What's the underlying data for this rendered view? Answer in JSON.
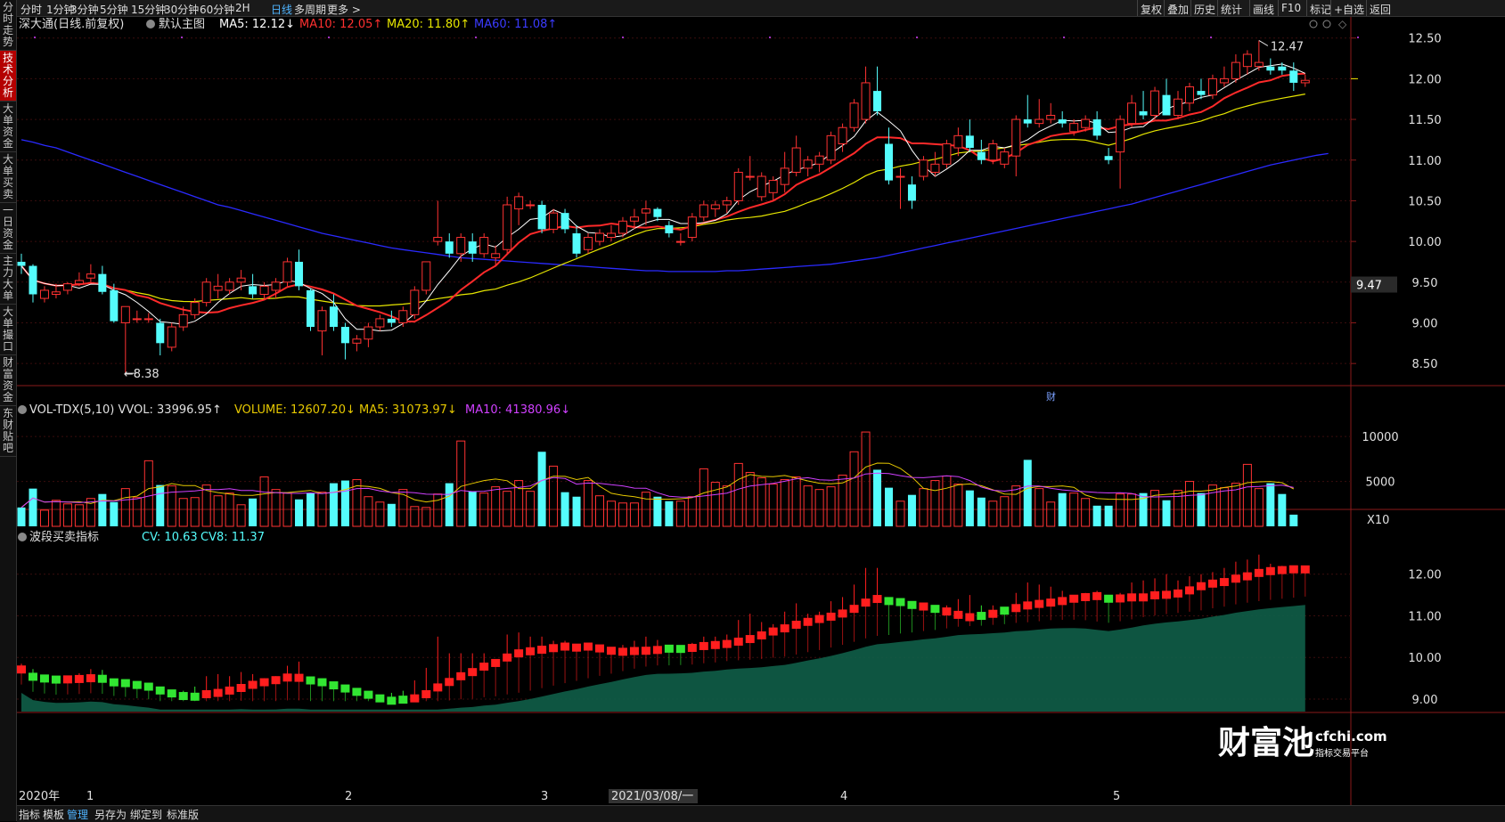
{
  "sidebar": [
    "分时走势",
    "技术分析",
    "大单资金",
    "大单买卖",
    "一日资金",
    "主力大单",
    "大单撮口",
    "财富资金",
    "东财贴吧"
  ],
  "sidebar_active": 1,
  "periods": [
    "分时",
    "1分钟",
    "3分钟",
    "5分钟",
    "15分钟",
    "30分钟",
    "60分钟",
    "2H",
    "日线",
    "多周期",
    "更多 >"
  ],
  "period_active": 8,
  "tools": [
    "复权",
    "叠加",
    "历史",
    "统计",
    "画线",
    "F10",
    "标记",
    "+自选",
    "返回"
  ],
  "main": {
    "title": "深大通(日线.前复权)",
    "template": "默认主图",
    "ma5": "MA5: 12.12↓",
    "ma10": "MA10: 12.05↑",
    "ma20": "MA20: 11.80↑",
    "ma60": "MA60: 11.08↑",
    "high_label": "12.47",
    "low_label": "8.38",
    "current_price": "9.47",
    "marker": "财",
    "yticks": [
      "12.50",
      "12.00",
      "11.50",
      "11.00",
      "10.50",
      "10.00",
      "9.50",
      "9.00",
      "8.50"
    ]
  },
  "volume": {
    "title": "VOL-TDX(5,10) VVOL: 33996.95↑",
    "volume": "VOLUME: 12607.20↓",
    "ma5": "MA5: 31073.97↓",
    "ma10": "MA10: 41380.96↓",
    "yticks": [
      "10000",
      "5000"
    ],
    "unit": "X10"
  },
  "indicator": {
    "title": "波段买卖指标",
    "cv": "CV: 10.63",
    "cv8": "CV8: 11.37",
    "yticks": [
      "12.00",
      "11.00",
      "10.00",
      "9.00"
    ]
  },
  "xaxis": {
    "labels": [
      "2020年",
      "1",
      "2",
      "3",
      "4",
      "5"
    ],
    "cursor": "2021/03/08/一"
  },
  "bottom_tabs": [
    "指标",
    "模板",
    "管理",
    "另存为",
    "绑定到",
    "标准版"
  ],
  "bottom_active": 2,
  "watermark": {
    "brand": "财富池",
    "site": "cfchi.com",
    "slogan": "指标交易平台"
  },
  "colors": {
    "up": "#ff3232",
    "down": "#54fcfc",
    "ma5": "#ffffff",
    "ma10": "#ff2a2a",
    "ma20": "#e6e600",
    "ma60": "#2a2aff",
    "ma_vol10": "#d040ff",
    "cloud": "#0f5e48"
  },
  "chart_data": {
    "type": "candlestick",
    "price_range": [
      8.25,
      12.65
    ],
    "candles": [
      [
        9.75,
        9.85,
        9.6,
        9.7
      ],
      [
        9.7,
        9.72,
        9.25,
        9.35
      ],
      [
        9.3,
        9.45,
        9.25,
        9.4
      ],
      [
        9.35,
        9.48,
        9.3,
        9.38
      ],
      [
        9.4,
        9.5,
        9.35,
        9.48
      ],
      [
        9.48,
        9.62,
        9.45,
        9.52
      ],
      [
        9.55,
        9.72,
        9.5,
        9.6
      ],
      [
        9.6,
        9.7,
        9.35,
        9.38
      ],
      [
        9.4,
        9.48,
        9.0,
        9.02
      ],
      [
        9.0,
        9.2,
        8.38,
        9.2
      ],
      [
        9.05,
        9.15,
        9.0,
        9.05
      ],
      [
        9.05,
        9.12,
        9.0,
        9.05
      ],
      [
        9.0,
        9.05,
        8.6,
        8.75
      ],
      [
        8.7,
        9.0,
        8.65,
        8.95
      ],
      [
        8.95,
        9.2,
        8.9,
        9.1
      ],
      [
        9.1,
        9.3,
        9.05,
        9.25
      ],
      [
        9.25,
        9.55,
        9.2,
        9.5
      ],
      [
        9.4,
        9.6,
        9.3,
        9.45
      ],
      [
        9.4,
        9.55,
        9.35,
        9.5
      ],
      [
        9.5,
        9.65,
        9.4,
        9.55
      ],
      [
        9.45,
        9.6,
        9.3,
        9.35
      ],
      [
        9.35,
        9.5,
        9.3,
        9.45
      ],
      [
        9.4,
        9.55,
        9.3,
        9.5
      ],
      [
        9.5,
        9.8,
        9.45,
        9.75
      ],
      [
        9.75,
        9.9,
        9.4,
        9.45
      ],
      [
        9.4,
        9.42,
        8.9,
        8.95
      ],
      [
        8.9,
        9.2,
        8.6,
        9.15
      ],
      [
        9.2,
        9.35,
        8.9,
        8.95
      ],
      [
        8.95,
        9.0,
        8.55,
        8.75
      ],
      [
        8.75,
        8.85,
        8.65,
        8.8
      ],
      [
        8.8,
        9.0,
        8.7,
        8.95
      ],
      [
        8.95,
        9.1,
        8.9,
        9.05
      ],
      [
        9.05,
        9.15,
        8.95,
        9.0
      ],
      [
        9.0,
        9.2,
        8.95,
        9.15
      ],
      [
        9.1,
        9.45,
        9.05,
        9.4
      ],
      [
        9.4,
        9.75,
        9.35,
        9.75
      ],
      [
        10.0,
        10.5,
        9.95,
        10.05
      ],
      [
        10.0,
        10.1,
        9.8,
        9.85
      ],
      [
        9.85,
        10.1,
        9.75,
        10.05
      ],
      [
        10.0,
        10.1,
        9.75,
        9.85
      ],
      [
        9.85,
        10.1,
        9.8,
        10.05
      ],
      [
        9.8,
        9.95,
        9.7,
        9.85
      ],
      [
        9.9,
        10.55,
        9.85,
        10.45
      ],
      [
        10.4,
        10.6,
        10.2,
        10.55
      ],
      [
        10.45,
        10.5,
        10.4,
        10.45
      ],
      [
        10.45,
        10.5,
        10.1,
        10.15
      ],
      [
        10.15,
        10.4,
        10.1,
        10.35
      ],
      [
        10.35,
        10.4,
        10.1,
        10.15
      ],
      [
        10.1,
        10.2,
        9.8,
        9.85
      ],
      [
        9.9,
        10.1,
        9.85,
        10.05
      ],
      [
        10.0,
        10.15,
        9.95,
        10.1
      ],
      [
        10.05,
        10.2,
        10.0,
        10.1
      ],
      [
        10.1,
        10.3,
        10.05,
        10.25
      ],
      [
        10.25,
        10.4,
        10.15,
        10.3
      ],
      [
        10.35,
        10.5,
        10.2,
        10.4
      ],
      [
        10.4,
        10.42,
        10.25,
        10.3
      ],
      [
        10.2,
        10.25,
        10.05,
        10.1
      ],
      [
        10.0,
        10.1,
        9.95,
        10.0
      ],
      [
        10.05,
        10.35,
        10.0,
        10.3
      ],
      [
        10.3,
        10.5,
        10.25,
        10.45
      ],
      [
        10.4,
        10.5,
        10.3,
        10.45
      ],
      [
        10.45,
        10.55,
        10.35,
        10.5
      ],
      [
        10.5,
        10.9,
        10.45,
        10.85
      ],
      [
        10.8,
        11.05,
        10.75,
        10.8
      ],
      [
        10.55,
        10.85,
        10.5,
        10.8
      ],
      [
        10.6,
        10.8,
        10.5,
        10.75
      ],
      [
        10.7,
        11.1,
        10.6,
        10.9
      ],
      [
        10.85,
        11.3,
        10.8,
        11.15
      ],
      [
        10.9,
        11.05,
        10.8,
        11.0
      ],
      [
        10.95,
        11.1,
        10.85,
        11.05
      ],
      [
        11.0,
        11.35,
        10.95,
        11.3
      ],
      [
        11.2,
        11.45,
        11.1,
        11.4
      ],
      [
        11.4,
        11.75,
        11.35,
        11.7
      ],
      [
        11.5,
        12.15,
        11.45,
        11.95
      ],
      [
        11.85,
        12.15,
        11.55,
        11.6
      ],
      [
        11.2,
        11.4,
        10.7,
        10.75
      ],
      [
        10.8,
        10.9,
        10.4,
        10.8
      ],
      [
        10.7,
        10.8,
        10.4,
        10.5
      ],
      [
        10.8,
        11.05,
        10.75,
        11.0
      ],
      [
        10.85,
        11.1,
        10.8,
        10.95
      ],
      [
        10.95,
        11.25,
        10.9,
        11.2
      ],
      [
        11.15,
        11.4,
        11.05,
        11.3
      ],
      [
        11.3,
        11.5,
        11.1,
        11.15
      ],
      [
        11.1,
        11.25,
        10.95,
        11.0
      ],
      [
        11.0,
        11.25,
        10.95,
        11.2
      ],
      [
        10.95,
        11.15,
        10.9,
        11.1
      ],
      [
        11.05,
        11.55,
        10.8,
        11.5
      ],
      [
        11.5,
        11.8,
        11.4,
        11.45
      ],
      [
        11.45,
        11.75,
        11.4,
        11.5
      ],
      [
        11.5,
        11.7,
        11.45,
        11.55
      ],
      [
        11.5,
        11.6,
        11.4,
        11.45
      ],
      [
        11.35,
        11.5,
        11.3,
        11.45
      ],
      [
        11.4,
        11.55,
        11.35,
        11.5
      ],
      [
        11.5,
        11.6,
        11.25,
        11.3
      ],
      [
        11.05,
        11.15,
        10.95,
        11.0
      ],
      [
        11.1,
        11.55,
        10.65,
        11.5
      ],
      [
        11.45,
        11.8,
        11.4,
        11.7
      ],
      [
        11.6,
        11.85,
        11.5,
        11.55
      ],
      [
        11.55,
        11.9,
        11.5,
        11.85
      ],
      [
        11.8,
        12.0,
        11.6,
        11.55
      ],
      [
        11.55,
        11.85,
        11.5,
        11.75
      ],
      [
        11.7,
        11.95,
        11.6,
        11.9
      ],
      [
        11.85,
        12.0,
        11.75,
        11.8
      ],
      [
        11.8,
        12.05,
        11.75,
        12.0
      ],
      [
        11.95,
        12.15,
        11.9,
        12.0
      ],
      [
        12.0,
        12.3,
        11.95,
        12.2
      ],
      [
        12.15,
        12.35,
        12.05,
        12.3
      ],
      [
        12.15,
        12.47,
        12.1,
        12.2
      ],
      [
        12.15,
        12.25,
        12.05,
        12.1
      ],
      [
        12.15,
        12.2,
        12.05,
        12.1
      ],
      [
        12.1,
        12.2,
        11.85,
        11.95
      ],
      [
        11.95,
        12.05,
        11.9,
        11.98
      ]
    ],
    "ma60": [
      11.25,
      11.22,
      11.18,
      11.15,
      11.1,
      11.05,
      11.0,
      10.95,
      10.9,
      10.85,
      10.8,
      10.75,
      10.7,
      10.65,
      10.6,
      10.55,
      10.5,
      10.45,
      10.42,
      10.38,
      10.34,
      10.3,
      10.26,
      10.22,
      10.18,
      10.14,
      10.1,
      10.07,
      10.04,
      10.01,
      9.98,
      9.95,
      9.92,
      9.9,
      9.88,
      9.86,
      9.84,
      9.82,
      9.8,
      9.79,
      9.78,
      9.77,
      9.76,
      9.75,
      9.74,
      9.73,
      9.72,
      9.71,
      9.7,
      9.69,
      9.68,
      9.67,
      9.66,
      9.65,
      9.64,
      9.64,
      9.63,
      9.63,
      9.63,
      9.63,
      9.63,
      9.64,
      9.64,
      9.65,
      9.66,
      9.67,
      9.68,
      9.69,
      9.7,
      9.71,
      9.72,
      9.74,
      9.76,
      9.78,
      9.8,
      9.83,
      9.86,
      9.89,
      9.92,
      9.95,
      9.98,
      10.01,
      10.04,
      10.07,
      10.1,
      10.13,
      10.16,
      10.19,
      10.22,
      10.25,
      10.28,
      10.31,
      10.34,
      10.37,
      10.4,
      10.43,
      10.46,
      10.5,
      10.54,
      10.58,
      10.62,
      10.66,
      10.7,
      10.74,
      10.78,
      10.82,
      10.86,
      10.9,
      10.94,
      10.97,
      11.0,
      11.03,
      11.06,
      11.08
    ],
    "volume": [
      2100,
      4200,
      1800,
      2900,
      2500,
      2400,
      3100,
      3600,
      2700,
      4200,
      3200,
      7300,
      4600,
      4500,
      3100,
      3200,
      4600,
      3400,
      3700,
      2400,
      3100,
      5500,
      4100,
      3700,
      3000,
      3700,
      3800,
      4800,
      5100,
      5200,
      3300,
      2700,
      2500,
      4100,
      2200,
      2100,
      3600,
      4800,
      9500,
      3900,
      3700,
      4400,
      3900,
      5100,
      3900,
      8300,
      6700,
      3800,
      3300,
      5100,
      3400,
      2800,
      2600,
      2600,
      3800,
      3300,
      2800,
      2800,
      3300,
      6400,
      4900,
      4500,
      7000,
      6000,
      5400,
      4700,
      5200,
      5500,
      4500,
      4100,
      4400,
      5700,
      8300,
      10500,
      6300,
      4300,
      2800,
      3500,
      4200,
      5100,
      5600,
      4700,
      4000,
      3200,
      2800,
      3300,
      4500,
      7400,
      4200,
      2700,
      3700,
      3700,
      3100,
      2300,
      2300,
      3600,
      3600,
      3700,
      4000,
      2900,
      4000,
      5000,
      3700,
      4600,
      4300,
      4800,
      6900,
      4200,
      4800,
      3600,
      1300
    ],
    "ind_ylim": [
      8.7,
      12.55
    ],
    "ind_cv8": [
      9.1,
      8.9,
      8.75,
      8.6
    ]
  }
}
